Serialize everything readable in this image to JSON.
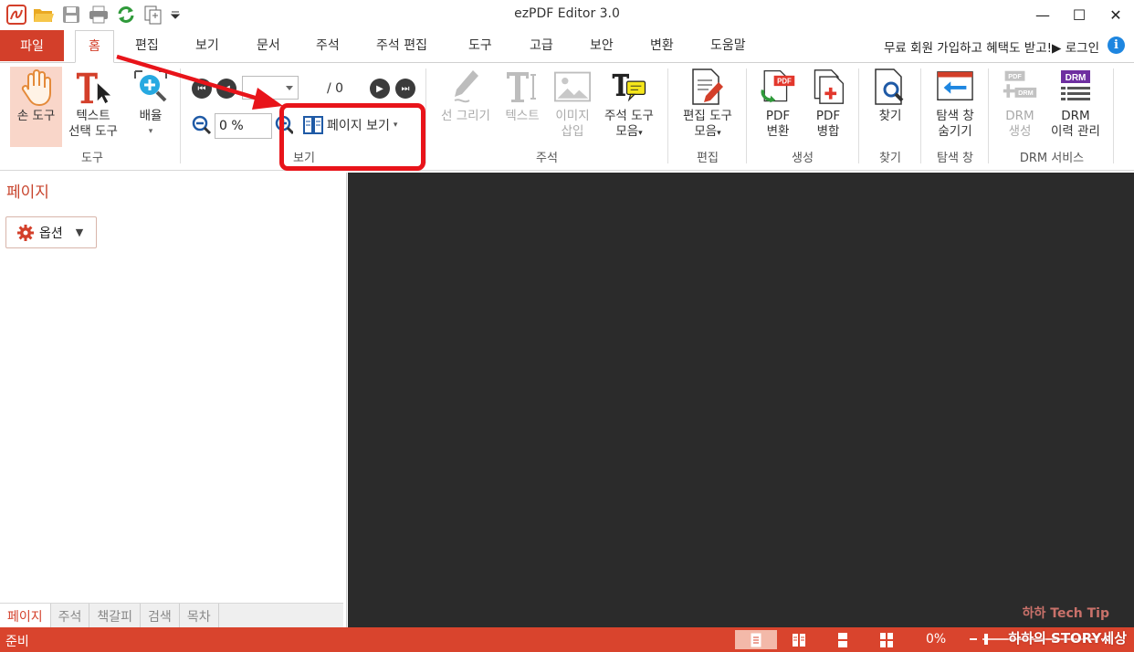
{
  "window": {
    "title": "ezPDF Editor 3.0",
    "controls": [
      "minimize-icon",
      "maximize-icon",
      "close-icon"
    ]
  },
  "quick_access": [
    "app-logo-icon",
    "open-folder-icon",
    "save-icon",
    "print-icon",
    "refresh-icon",
    "pages-icon",
    "dropdown-icon"
  ],
  "menu": {
    "file": "파일",
    "tabs": [
      "홈",
      "편집",
      "보기",
      "문서",
      "주석",
      "주석 편집",
      "도구",
      "고급",
      "보안",
      "변환",
      "도움말"
    ],
    "active_tab": "홈",
    "promo": "무료 회원 가입하고 혜택도 받고!▶ 로그인",
    "info": "i"
  },
  "ribbon": {
    "tools": {
      "hand": "손 도구",
      "text_select_1": "텍스트",
      "text_select_2": "선택 도구",
      "zoom": "배율",
      "group": "도구"
    },
    "view": {
      "page_count": "/ 0",
      "zoom_value": "0 %",
      "page_view": "페이지 보기",
      "group": "보기"
    },
    "annot": {
      "draw": "선 그리기",
      "text": "텍스트",
      "image_1": "이미지",
      "image_2": "삽입",
      "tools_1": "주석 도구",
      "tools_2": "모음",
      "group": "주석"
    },
    "edit": {
      "tools_1": "편집 도구",
      "tools_2": "모음",
      "group": "편집"
    },
    "create": {
      "convert_1": "PDF",
      "convert_2": "변환",
      "merge_1": "PDF",
      "merge_2": "병합",
      "group": "생성"
    },
    "find": {
      "label": "찾기",
      "group": "찾기"
    },
    "nav": {
      "label_1": "탐색 창",
      "label_2": "숨기기",
      "group": "탐색 창"
    },
    "drm": {
      "create_1": "DRM",
      "create_2": "생성",
      "history_1": "DRM",
      "history_2": "이력 관리",
      "group": "DRM 서비스",
      "badge_pdf": "PDF",
      "badge_drm": "DRM"
    }
  },
  "left_panel": {
    "title": "페이지",
    "options": "옵션",
    "bottom_tabs": [
      "페이지",
      "주석",
      "책갈피",
      "검색",
      "목차"
    ]
  },
  "watermark": {
    "line1": "하하 Tech Tip",
    "line2": "하하의 STORY세상"
  },
  "status": {
    "text": "준비",
    "zoom": "0%",
    "view_modes": [
      "single-page-icon",
      "two-page-icon",
      "continuous-icon",
      "continuous-two-page-icon"
    ]
  },
  "colors": {
    "accent": "#d33f2a",
    "highlight": "#e8141a",
    "document_bg": "#2b2b2b"
  }
}
